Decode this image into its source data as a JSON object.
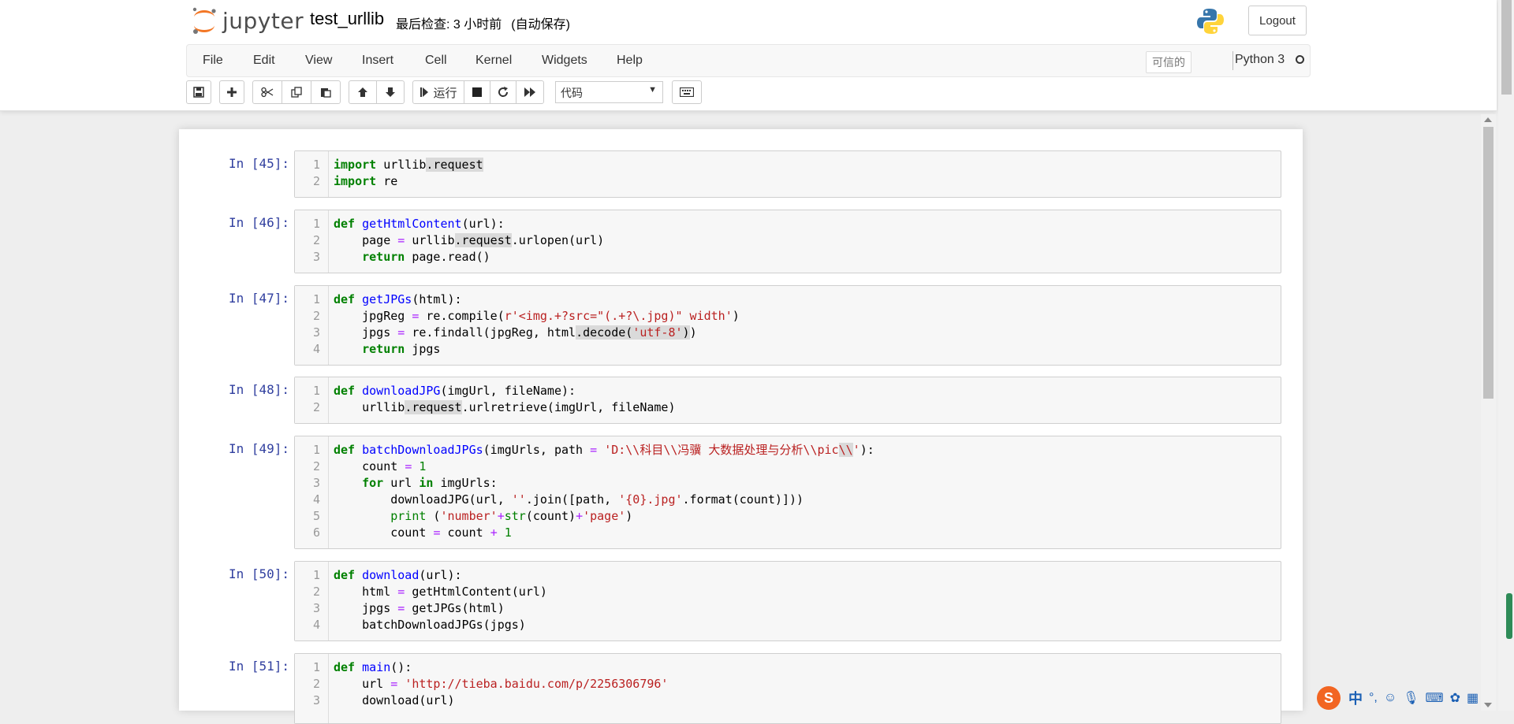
{
  "app": {
    "logo_text": "jupyter",
    "notebook_name": "test_urllib",
    "checkpoint": "最后检查: 3 小时前",
    "autosave": "(自动保存)",
    "logout_label": "Logout"
  },
  "menu": [
    "File",
    "Edit",
    "View",
    "Insert",
    "Cell",
    "Kernel",
    "Widgets",
    "Help"
  ],
  "status": {
    "trusted": "可信的",
    "kernel": "Python 3"
  },
  "toolbar": {
    "run_label": "运行",
    "cell_type": "代码",
    "icons": [
      "save-icon",
      "plus-icon",
      "cut-icon",
      "copy-icon",
      "paste-icon",
      "arrow-up-icon",
      "arrow-down-icon",
      "step-forward-icon",
      "stop-icon",
      "restart-icon",
      "fast-forward-icon",
      "keyboard-icon"
    ]
  },
  "cells": [
    {
      "prompt": "In  [45]:",
      "lines": [
        "import urllib.request",
        "import re"
      ]
    },
    {
      "prompt": "In  [46]:",
      "lines": [
        "def getHtmlContent(url):",
        "    page = urllib.request.urlopen(url)",
        "    return page.read()"
      ]
    },
    {
      "prompt": "In  [47]:",
      "lines": [
        "def getJPGs(html):",
        "    jpgReg = re.compile(r'<img.+?src=\"(.+?\\.jpg)\" width')",
        "    jpgs = re.findall(jpgReg, html.decode('utf-8'))",
        "    return jpgs"
      ]
    },
    {
      "prompt": "In  [48]:",
      "lines": [
        "def downloadJPG(imgUrl, fileName):",
        "    urllib.request.urlretrieve(imgUrl, fileName)"
      ]
    },
    {
      "prompt": "In  [49]:",
      "lines": [
        "def batchDownloadJPGs(imgUrls, path = 'D:\\\\科目\\\\冯骥 大数据处理与分析\\\\pic\\\\'):",
        "    count = 1",
        "    for url in imgUrls:",
        "        downloadJPG(url, ''.join([path, '{0}.jpg'.format(count)]))",
        "        print ('number'+str(count)+'page')",
        "        count = count + 1"
      ]
    },
    {
      "prompt": "In  [50]:",
      "lines": [
        "def download(url):",
        "    html = getHtmlContent(url)",
        "    jpgs = getJPGs(html)",
        "    batchDownloadJPGs(jpgs)"
      ]
    },
    {
      "prompt": "In  [51]:",
      "lines": [
        "def main():",
        "    url = 'http://tieba.baidu.com/p/2256306796'",
        "    download(url)"
      ]
    }
  ],
  "ime": {
    "logo": "S",
    "lang": "中"
  }
}
